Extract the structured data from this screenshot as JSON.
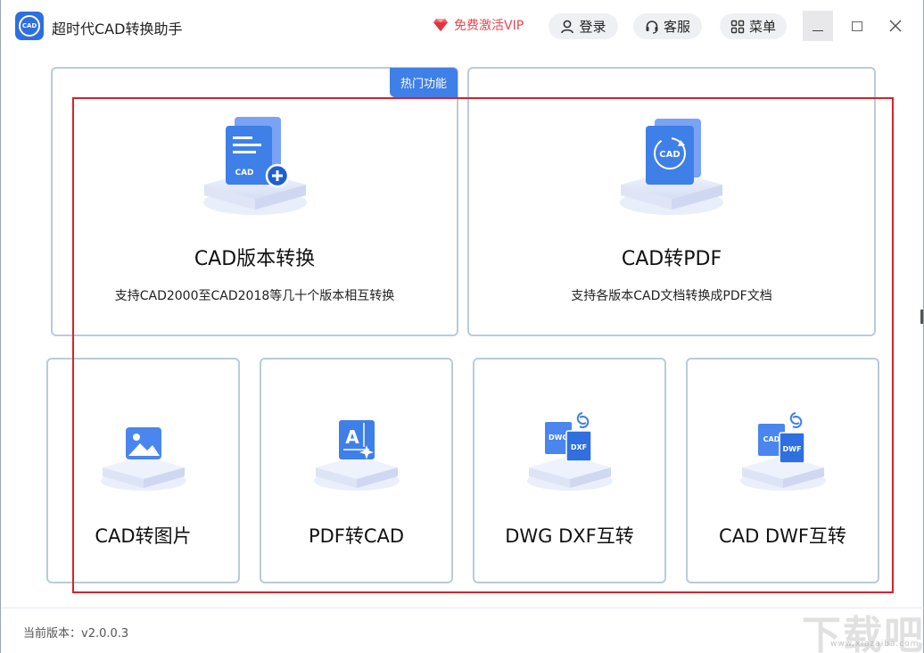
{
  "app": {
    "title": "超时代CAD转换助手",
    "logo_text": "CAD"
  },
  "header": {
    "vip_label": "免费激活VIP",
    "login_label": "登录",
    "service_label": "客服",
    "menu_label": "菜单"
  },
  "cards": {
    "version_convert": {
      "badge": "热门功能",
      "title": "CAD版本转换",
      "desc": "支持CAD2000至CAD2018等几十个版本相互转换",
      "icon_text": "CAD"
    },
    "cad_to_pdf": {
      "title": "CAD转PDF",
      "desc": "支持各版本CAD文档转换成PDF文档",
      "icon_text": "CAD"
    },
    "cad_to_image": {
      "title": "CAD转图片"
    },
    "pdf_to_cad": {
      "title": "PDF转CAD",
      "icon_text": "A"
    },
    "dwg_dxf": {
      "title": "DWG DXF互转",
      "icon_text_1": "DWG",
      "icon_text_2": "DXF"
    },
    "cad_dwf": {
      "title": "CAD DWF互转",
      "icon_text_1": "CAD",
      "icon_text_2": "DWF"
    }
  },
  "footer": {
    "version": "当前版本：v2.0.0.3"
  },
  "watermark": {
    "text": "下载吧",
    "sub": "www.xiazaiba.com"
  },
  "colors": {
    "accent": "#3f7fe8",
    "vip": "#e8474f",
    "card_border": "#b9ccd8",
    "highlight": "#d6232b"
  }
}
